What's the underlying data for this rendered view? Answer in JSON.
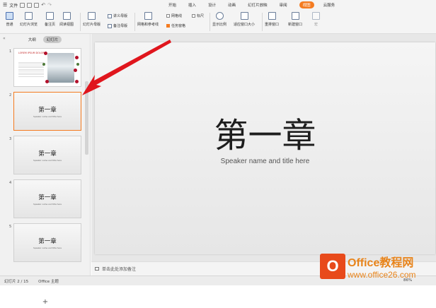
{
  "menubar": {
    "file_label": "文件",
    "tabs": [
      "开始",
      "插入",
      "设计",
      "动画",
      "幻灯片放映",
      "审阅",
      "视图",
      "云服务"
    ],
    "active_tab": "视图"
  },
  "ribbon": {
    "normal": "普通",
    "slide_sorter": "幻灯片浏览",
    "notes_page": "备注页",
    "reading_view": "阅读视图",
    "slide_master": "幻灯片母版",
    "handout_master": "讲义母版",
    "notes_master": "备注母版",
    "grid_guides": "网格和参考线",
    "gridlines": "网格线",
    "ruler": "标尺",
    "task_pane": "任务窗格",
    "zoom": "显示比例",
    "fit_window": "适应窗口大小",
    "arrange_windows": "重排窗口",
    "new_window": "新建窗口",
    "macro": "宏"
  },
  "panel": {
    "outline_tab": "大纲",
    "slides_tab": "幻灯片",
    "collapse_icon": "«",
    "add_slide": "+",
    "slides": [
      {
        "num": "1",
        "title": "",
        "subtitle": "",
        "type": "cover",
        "cover_text": "LOREM IPSUM DOLOR"
      },
      {
        "num": "2",
        "title": "第一章",
        "subtitle": "Speaker name and title here",
        "selected": true
      },
      {
        "num": "3",
        "title": "第一章",
        "subtitle": "Speaker name and title here"
      },
      {
        "num": "4",
        "title": "第一章",
        "subtitle": "Speaker name and title here"
      },
      {
        "num": "5",
        "title": "第一章",
        "subtitle": "Speaker name and title here"
      }
    ]
  },
  "slide": {
    "title": "第一章",
    "subtitle": "Speaker name and title here"
  },
  "notes": {
    "placeholder": "单击此处添加备注"
  },
  "statusbar": {
    "slide_counter": "幻灯片 2 / 15",
    "theme": "Office 主题",
    "zoom": "86%"
  },
  "watermark": {
    "logo_char": "O",
    "line1": "Office教程网",
    "line2": "www.office26.com"
  },
  "colors": {
    "accent": "#f47b20",
    "arrow": "#e0161d",
    "watermark": "#e8841b"
  }
}
